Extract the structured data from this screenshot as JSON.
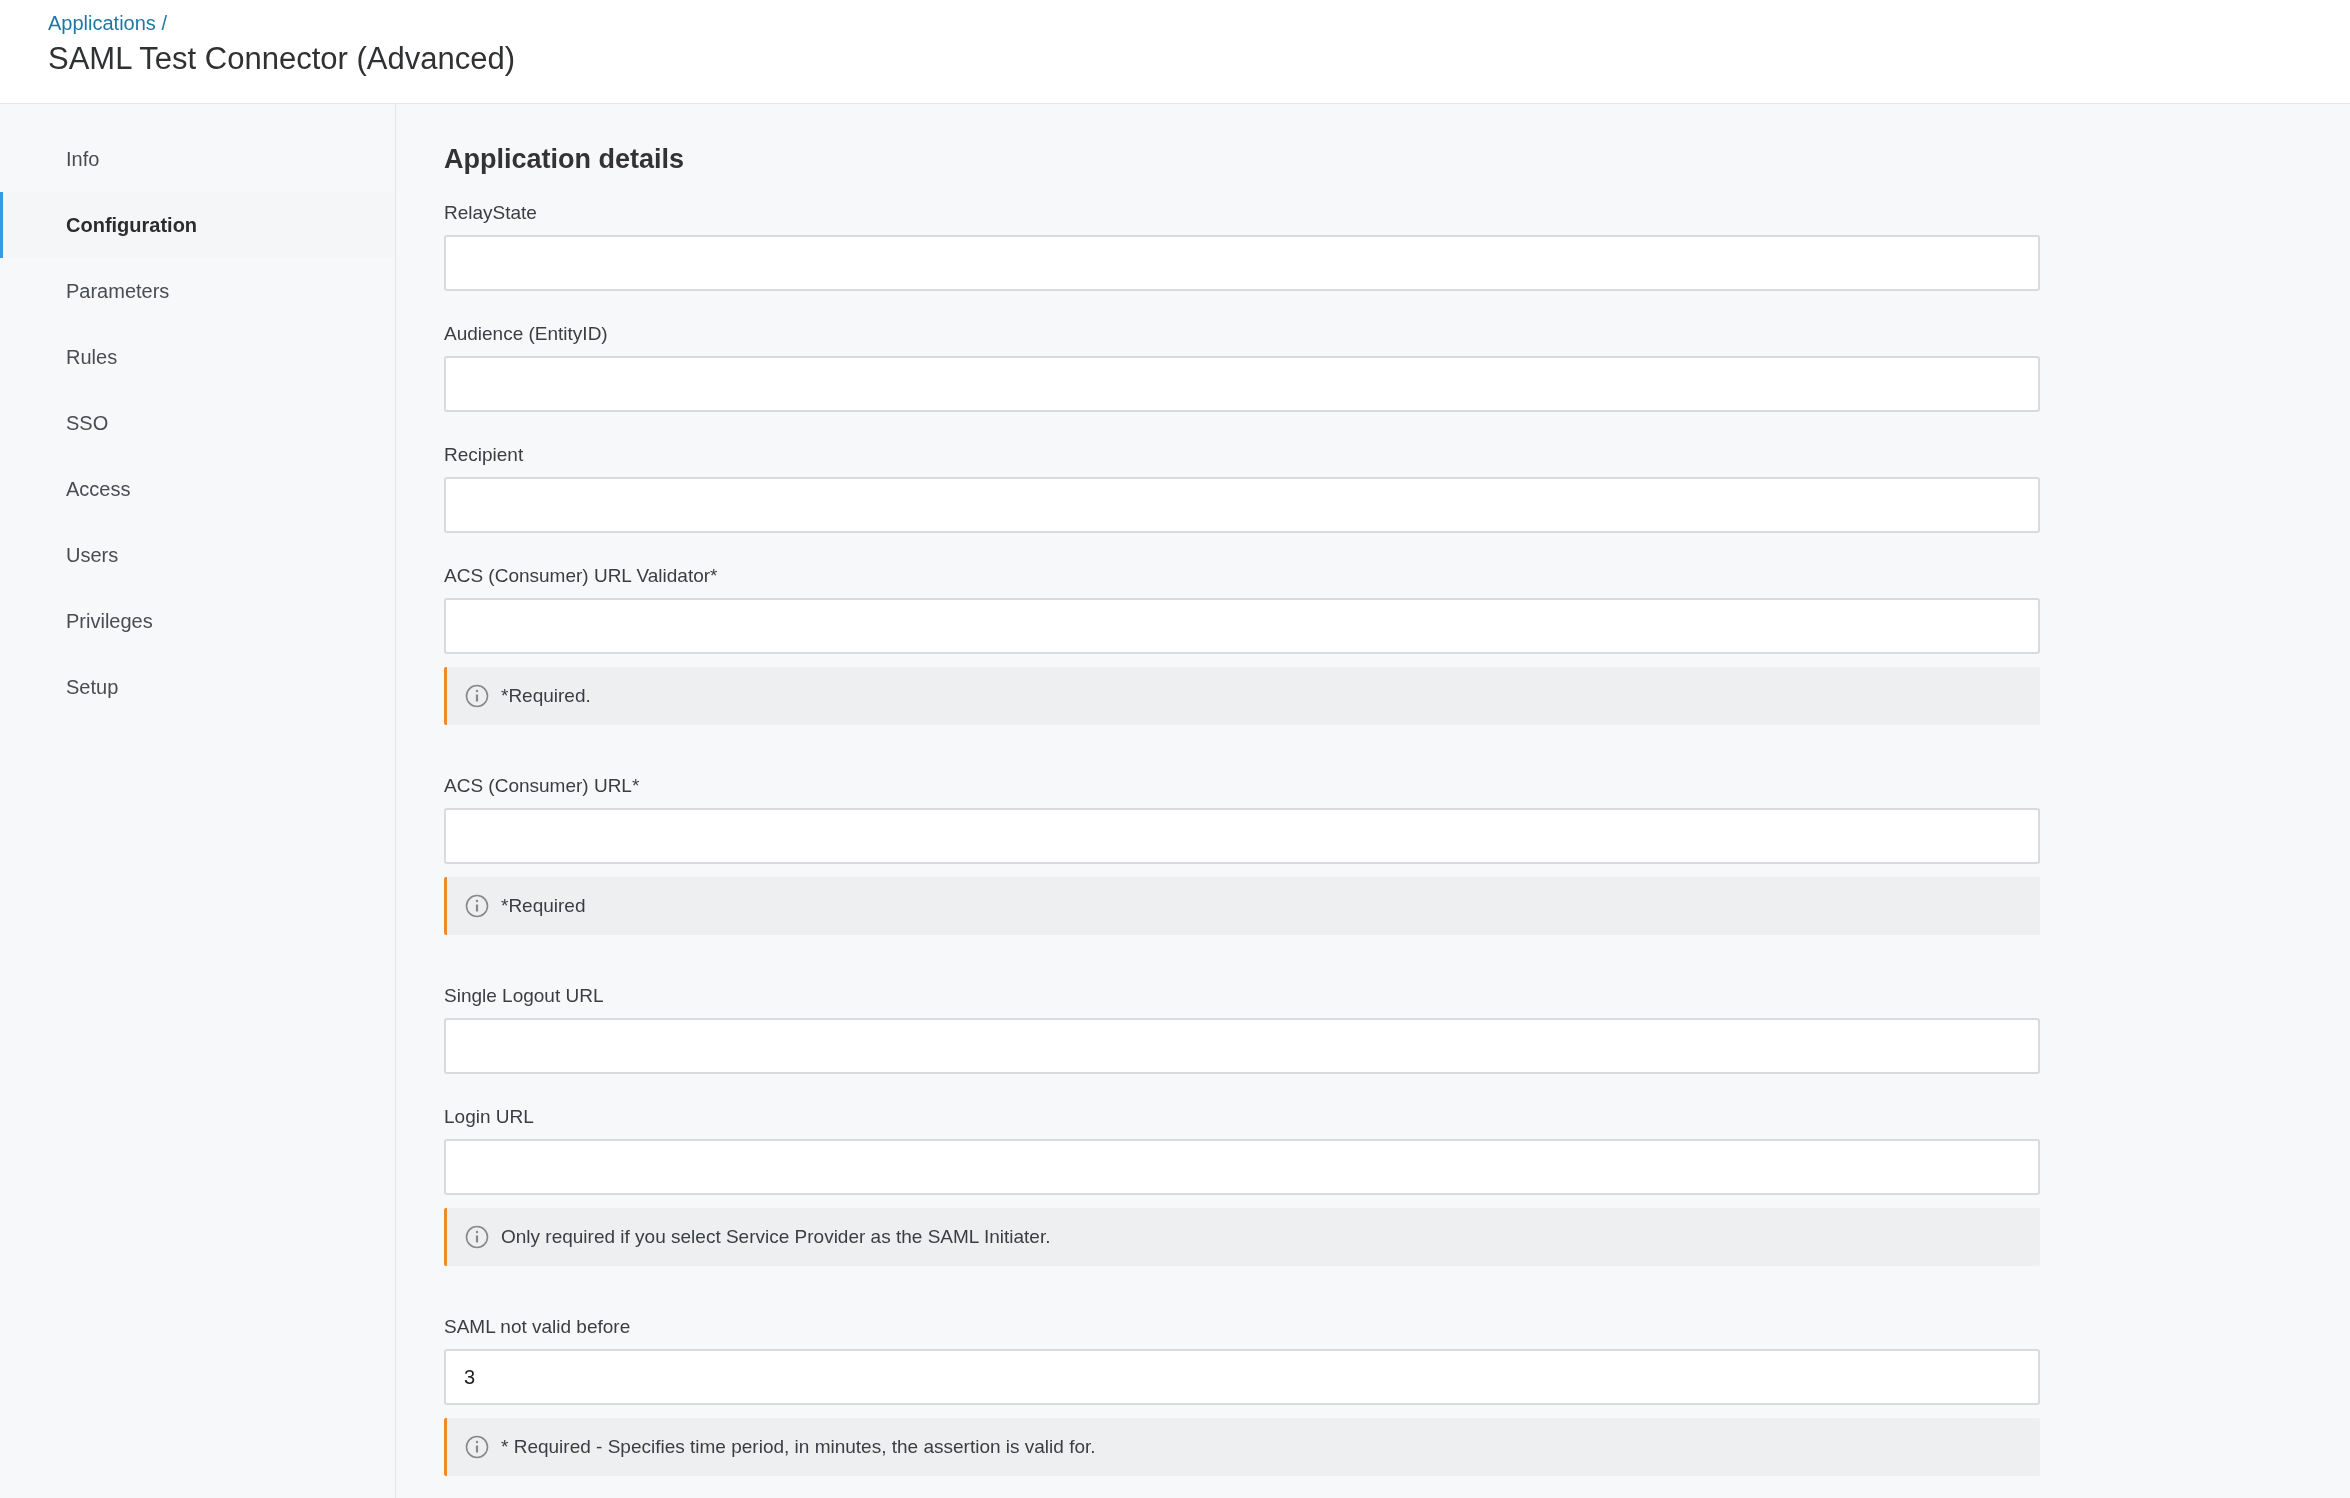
{
  "breadcrumb": {
    "link": "Applications",
    "separator": "/"
  },
  "title": "SAML Test Connector (Advanced)",
  "sidebar": {
    "items": [
      {
        "label": "Info",
        "selected": false
      },
      {
        "label": "Configuration",
        "selected": true
      },
      {
        "label": "Parameters",
        "selected": false
      },
      {
        "label": "Rules",
        "selected": false
      },
      {
        "label": "SSO",
        "selected": false
      },
      {
        "label": "Access",
        "selected": false
      },
      {
        "label": "Users",
        "selected": false
      },
      {
        "label": "Privileges",
        "selected": false
      },
      {
        "label": "Setup",
        "selected": false
      }
    ]
  },
  "section": {
    "heading": "Application details",
    "fields": [
      {
        "label": "RelayState"
      },
      {
        "label": "Audience (EntityID)"
      },
      {
        "label": "Recipient"
      },
      {
        "label": "ACS (Consumer) URL Validator*",
        "note": "*Required."
      },
      {
        "label": "ACS (Consumer) URL*",
        "note": "*Required"
      },
      {
        "label": "Single Logout URL"
      },
      {
        "label": "Login URL",
        "note": "Only required if you select Service Provider as the SAML Initiater."
      },
      {
        "label": "SAML not valid before",
        "value": "3",
        "note": "* Required - Specifies time period, in minutes, the assertion is valid for."
      }
    ]
  }
}
